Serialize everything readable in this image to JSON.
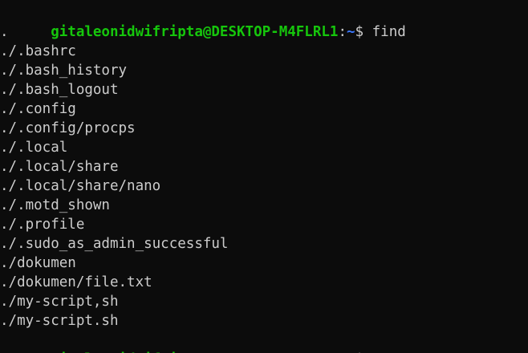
{
  "terminal": {
    "prompt": {
      "user_host": "gitaleonidwifripta@DESKTOP-M4FLRL1",
      "separator": ":",
      "path": "~",
      "symbol": "$"
    },
    "command": "find",
    "output": [
      ".",
      "./.bashrc",
      "./.bash_history",
      "./.bash_logout",
      "./.config",
      "./.config/procps",
      "./.local",
      "./.local/share",
      "./.local/share/nano",
      "./.motd_shown",
      "./.profile",
      "./.sudo_as_admin_successful",
      "./dokumen",
      "./dokumen/file.txt",
      "./my-script,sh",
      "./my-script.sh"
    ],
    "colors": {
      "background": "#0c0c0c",
      "text": "#cccccc",
      "user_host": "#16c60c",
      "path": "#3b78ff"
    }
  }
}
